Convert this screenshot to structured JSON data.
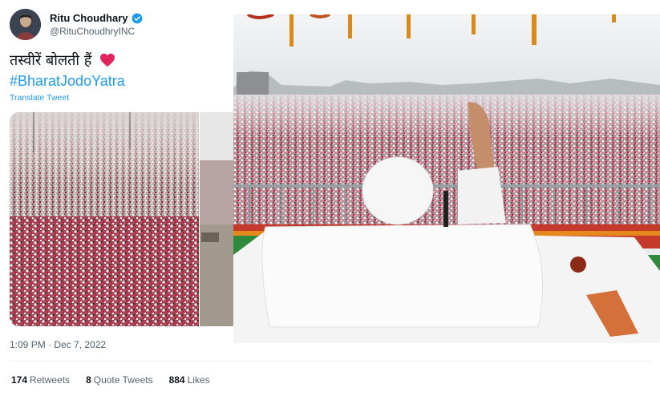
{
  "author": {
    "name": "Ritu Choudhary",
    "handle": "@RituChoudhryINC",
    "verified": true
  },
  "tweet": {
    "text": "तस्वीरें बोलती हैं",
    "hashtag": "#BharatJodoYatra",
    "translate_label": "Translate Tweet",
    "emoji": "heart-icon"
  },
  "meta": {
    "timestamp": "1:09 PM · Dec 7, 2022"
  },
  "stats": {
    "retweets_count": "174",
    "retweets_label": "Retweets",
    "quotes_count": "8",
    "quotes_label": "Quote Tweets",
    "likes_count": "884",
    "likes_label": "Likes"
  },
  "colors": {
    "link": "#1d9bf0",
    "secondary_text": "#536471",
    "heart": "#e0245e"
  }
}
